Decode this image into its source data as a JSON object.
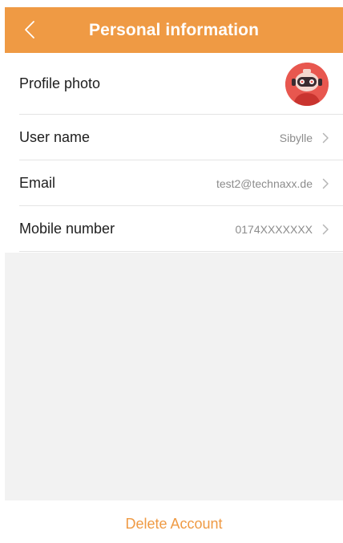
{
  "header": {
    "title": "Personal information",
    "back_icon": "chevron-left-icon",
    "background": "#ef9a44"
  },
  "rows": [
    {
      "label": "Profile photo",
      "value": "",
      "icon": "avatar"
    },
    {
      "label": "User name",
      "value": "Sibylle",
      "icon": "chevron-right-icon"
    },
    {
      "label": "Email",
      "value": "test2@technaxx.de",
      "icon": "chevron-right-icon"
    },
    {
      "label": "Mobile number",
      "value": "0174XXXXXXX",
      "icon": "chevron-right-icon"
    }
  ],
  "footer": {
    "delete_label": "Delete Account",
    "accent": "#ef9a44"
  }
}
